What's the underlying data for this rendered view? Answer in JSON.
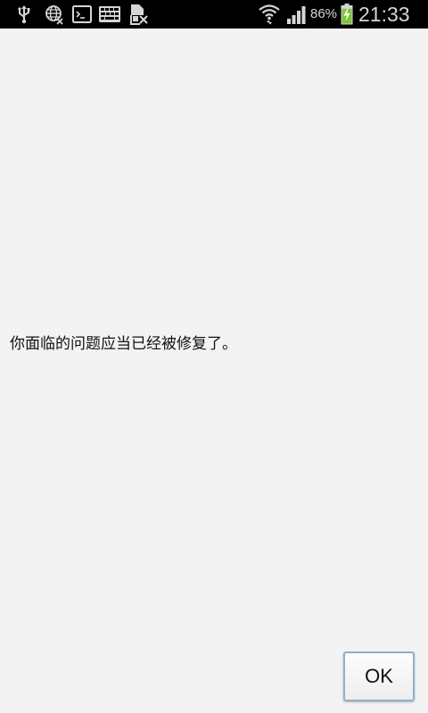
{
  "status_bar": {
    "left_icons": [
      "usb-icon",
      "globe-icon",
      "terminal-icon",
      "keyboard-icon",
      "sim-card-icon"
    ],
    "right_icons": [
      "wifi-icon",
      "signal-icon",
      "battery-charging-icon"
    ],
    "battery_percent": "86%",
    "battery_level": 0.86,
    "time": "21:33"
  },
  "dialog": {
    "message": "你面临的问题应当已经被修复了。",
    "ok_label": "OK"
  },
  "colors": {
    "status_bar_bg": "#000000",
    "status_icon": "#d6d6d6",
    "battery_charge": "#7cc53b",
    "screen_bg": "#f3f3f3",
    "button_border": "#8fb0cc"
  }
}
